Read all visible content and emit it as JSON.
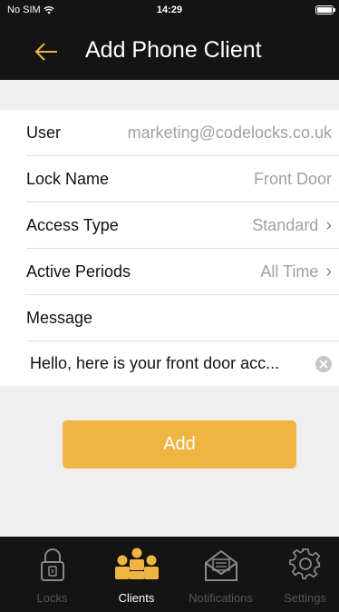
{
  "status_bar": {
    "carrier": "No SIM",
    "time": "14:29"
  },
  "header": {
    "title": "Add Phone Client",
    "back_icon": "back-arrow-icon"
  },
  "colors": {
    "accent": "#efb442",
    "bar_bg": "#141414",
    "page_bg": "#efefef"
  },
  "form": {
    "user": {
      "label": "User",
      "value": "marketing@codelocks.co.uk"
    },
    "lock_name": {
      "label": "Lock Name",
      "value": "Front Door"
    },
    "access_type": {
      "label": "Access Type",
      "value": "Standard"
    },
    "active_periods": {
      "label": "Active Periods",
      "value": "All Time"
    },
    "message": {
      "label": "Message",
      "value": "Hello, here is your front door acc..."
    }
  },
  "add_button": {
    "label": "Add"
  },
  "tabbar": {
    "tabs": [
      {
        "label": "Locks",
        "icon": "lock-icon",
        "active": false
      },
      {
        "label": "Clients",
        "icon": "users-icon",
        "active": true
      },
      {
        "label": "Notifications",
        "icon": "envelope-icon",
        "active": false
      },
      {
        "label": "Settings",
        "icon": "gear-icon",
        "active": false
      }
    ]
  }
}
